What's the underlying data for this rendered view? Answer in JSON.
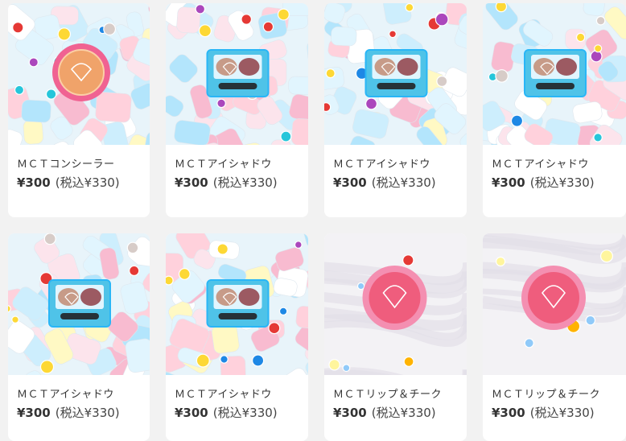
{
  "products": [
    {
      "name": "ＭＣＴコンシーラー",
      "price": "¥300",
      "tax": "(税込¥330)",
      "kind": "concealer",
      "bg": "marshmallow"
    },
    {
      "name": "ＭＣＴアイシャドウ",
      "price": "¥300",
      "tax": "(税込¥330)",
      "kind": "eyeshadow",
      "bg": "marshmallow"
    },
    {
      "name": "ＭＣＴアイシャドウ",
      "price": "¥300",
      "tax": "(税込¥330)",
      "kind": "eyeshadow",
      "bg": "marshmallow"
    },
    {
      "name": "ＭＣＴアイシャドウ",
      "price": "¥300",
      "tax": "(税込¥330)",
      "kind": "eyeshadow",
      "bg": "marshmallow"
    },
    {
      "name": "ＭＣＴアイシャドウ",
      "price": "¥300",
      "tax": "(税込¥330)",
      "kind": "eyeshadow",
      "bg": "marshmallow"
    },
    {
      "name": "ＭＣＴアイシャドウ",
      "price": "¥300",
      "tax": "(税込¥330)",
      "kind": "eyeshadow",
      "bg": "marshmallow"
    },
    {
      "name": "ＭＣＴリップ＆チーク",
      "price": "¥300",
      "tax": "(税込¥330)",
      "kind": "lipcheek",
      "bg": "fabric"
    },
    {
      "name": "ＭＣＴリップ＆チーク",
      "price": "¥300",
      "tax": "(税込¥330)",
      "kind": "lipcheek",
      "bg": "fabric"
    }
  ],
  "colors": {
    "page_bg": "#f2f2f2",
    "card_bg": "#ffffff",
    "text": "#333333",
    "compact_blue": "#4fc3e8",
    "compact_pink": "#f06292"
  }
}
